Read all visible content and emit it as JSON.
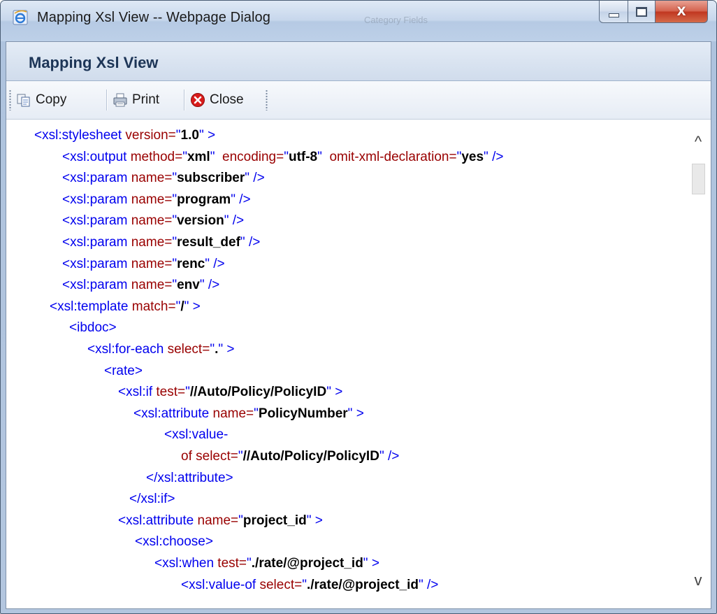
{
  "window": {
    "title": "Mapping Xsl View -- Webpage Dialog",
    "background_ghost_text": "Category Fields",
    "close_glyph": "X"
  },
  "panel": {
    "title": "Mapping Xsl View"
  },
  "toolbar": {
    "copy_label": "Copy",
    "print_label": "Print",
    "close_label": "Close"
  },
  "scroll": {
    "up_glyph": "^",
    "down_glyph": "v"
  },
  "xml_lines": [
    [
      [
        "t",
        "<xsl:stylesheet "
      ],
      [
        "a",
        "version="
      ],
      [
        "q",
        "\""
      ],
      [
        "v",
        "1.0"
      ],
      [
        "q",
        "\" >"
      ]
    ],
    [
      [
        "t",
        "<xsl:output "
      ],
      [
        "a",
        "method="
      ],
      [
        "q",
        "\""
      ],
      [
        "v",
        "xml"
      ],
      [
        "q",
        "\"  "
      ],
      [
        "a",
        "encoding="
      ],
      [
        "q",
        "\""
      ],
      [
        "v",
        "utf-8"
      ],
      [
        "q",
        "\"  "
      ],
      [
        "a",
        "omit-xml-declaration="
      ],
      [
        "q",
        "\""
      ],
      [
        "v",
        "yes"
      ],
      [
        "q",
        "\" />"
      ]
    ],
    [
      [
        "t",
        "<xsl:param "
      ],
      [
        "a",
        "name="
      ],
      [
        "q",
        "\""
      ],
      [
        "v",
        "subscriber"
      ],
      [
        "q",
        "\" />"
      ]
    ],
    [
      [
        "t",
        "<xsl:param "
      ],
      [
        "a",
        "name="
      ],
      [
        "q",
        "\""
      ],
      [
        "v",
        "program"
      ],
      [
        "q",
        "\" />"
      ]
    ],
    [
      [
        "t",
        "<xsl:param "
      ],
      [
        "a",
        "name="
      ],
      [
        "q",
        "\""
      ],
      [
        "v",
        "version"
      ],
      [
        "q",
        "\" />"
      ]
    ],
    [
      [
        "t",
        "<xsl:param "
      ],
      [
        "a",
        "name="
      ],
      [
        "q",
        "\""
      ],
      [
        "v",
        "result_def"
      ],
      [
        "q",
        "\" />"
      ]
    ],
    [
      [
        "t",
        "<xsl:param "
      ],
      [
        "a",
        "name="
      ],
      [
        "q",
        "\""
      ],
      [
        "v",
        "renc"
      ],
      [
        "q",
        "\" />"
      ]
    ],
    [
      [
        "t",
        "<xsl:param "
      ],
      [
        "a",
        "name="
      ],
      [
        "q",
        "\""
      ],
      [
        "v",
        "env"
      ],
      [
        "q",
        "\" />"
      ]
    ],
    [
      [
        "t",
        "<xsl:template "
      ],
      [
        "a",
        "match="
      ],
      [
        "q",
        "\""
      ],
      [
        "v",
        "/"
      ],
      [
        "q",
        "\" >"
      ]
    ],
    [
      [
        "t",
        "<ibdoc>"
      ]
    ],
    [
      [
        "t",
        "<xsl:for-each "
      ],
      [
        "a",
        "select="
      ],
      [
        "q",
        "\""
      ],
      [
        "v",
        "."
      ],
      [
        "q",
        "\" >"
      ]
    ],
    [
      [
        "t",
        "<rate>"
      ]
    ],
    [
      [
        "t",
        "<xsl:if "
      ],
      [
        "a",
        "test="
      ],
      [
        "q",
        "\""
      ],
      [
        "v",
        "//Auto/Policy/PolicyID"
      ],
      [
        "q",
        "\" >"
      ]
    ],
    [
      [
        "t",
        "<xsl:attribute "
      ],
      [
        "a",
        "name="
      ],
      [
        "q",
        "\""
      ],
      [
        "v",
        "PolicyNumber"
      ],
      [
        "q",
        "\" >"
      ]
    ],
    [
      [
        "t",
        "<xsl:value-"
      ]
    ],
    [
      [
        "a",
        "of select="
      ],
      [
        "q",
        "\""
      ],
      [
        "v",
        "//Auto/Policy/PolicyID"
      ],
      [
        "q",
        "\" />"
      ]
    ],
    [
      [
        "t",
        "</xsl:attribute>"
      ]
    ],
    [
      [
        "t",
        "</xsl:if>"
      ]
    ],
    [
      [
        "t",
        "<xsl:attribute "
      ],
      [
        "a",
        "name="
      ],
      [
        "q",
        "\""
      ],
      [
        "v",
        "project_id"
      ],
      [
        "q",
        "\" >"
      ]
    ],
    [
      [
        "t",
        "<xsl:choose>"
      ]
    ],
    [
      [
        "t",
        "<xsl:when "
      ],
      [
        "a",
        "test="
      ],
      [
        "q",
        "\""
      ],
      [
        "v",
        "./rate/@project_id"
      ],
      [
        "q",
        "\" >"
      ]
    ],
    [
      [
        "t",
        "<xsl:value-of "
      ],
      [
        "a",
        "select="
      ],
      [
        "q",
        "\""
      ],
      [
        "v",
        "./rate/@project_id"
      ],
      [
        "q",
        "\" />"
      ]
    ]
  ]
}
